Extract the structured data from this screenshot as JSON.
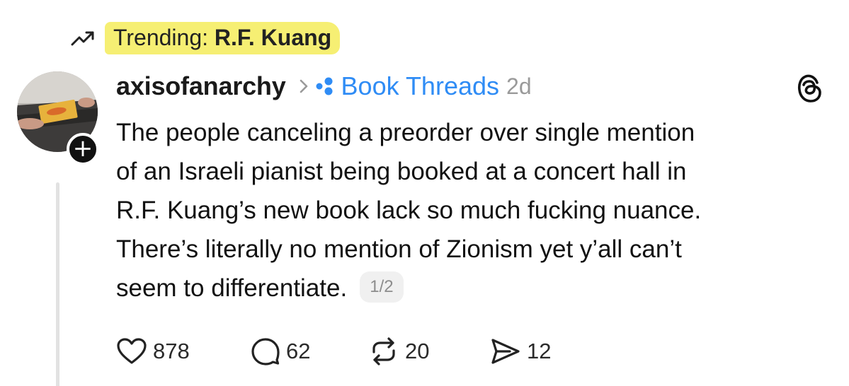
{
  "trending": {
    "prefix": "Trending:",
    "topic": "R.F. Kuang",
    "highlight_color": "#f6ef73",
    "icon": "trending-up-icon"
  },
  "post": {
    "author": {
      "username": "axisofanarchy",
      "avatar": "avatar-photo",
      "follow_icon": "plus-icon"
    },
    "community": {
      "name": "Book Threads",
      "icon": "community-dots-icon",
      "color": "#2f8cf5"
    },
    "time_ago": "2d",
    "text_lines": [
      "The people canceling a preorder over single mention",
      "of an Israeli pianist being booked at a concert hall in",
      "R.F. Kuang’s new book lack so much fucking nuance.",
      "There’s literally no mention of Zionism yet y’all can’t",
      "seem to differentiate."
    ],
    "page_counter": "1/2",
    "actions": {
      "likes": "878",
      "replies": "62",
      "reposts": "20",
      "shares": "12"
    }
  },
  "app_logo": "threads-logo-icon"
}
